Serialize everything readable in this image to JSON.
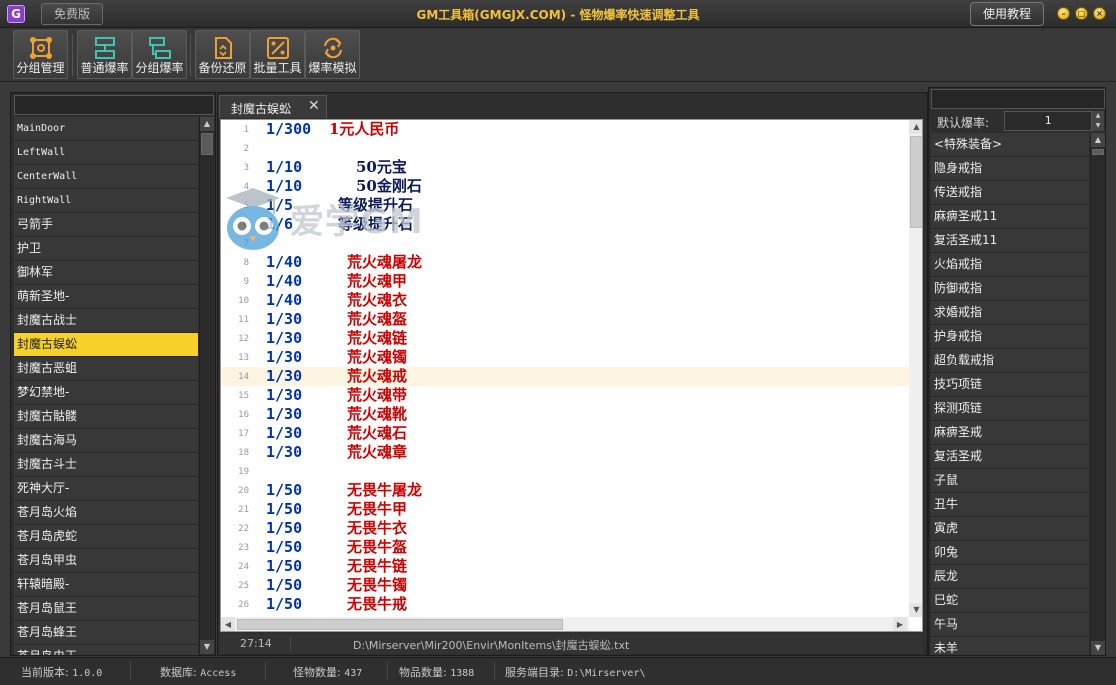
{
  "titlebar": {
    "free_label": "免费版",
    "title": "GM工具箱(GMGJX.COM) - 怪物爆率快速调整工具",
    "help_label": "使用教程"
  },
  "toolbar": {
    "buttons": [
      {
        "label": "分组管理",
        "icon": "group-manage-icon"
      },
      {
        "label": "普通爆率",
        "icon": "normal-droprate-icon"
      },
      {
        "label": "分组爆率",
        "icon": "group-droprate-icon"
      },
      {
        "label": "备份还原",
        "icon": "backup-restore-icon"
      },
      {
        "label": "批量工具",
        "icon": "batch-tool-icon"
      },
      {
        "label": "爆率模拟",
        "icon": "droprate-sim-icon"
      }
    ]
  },
  "monster_list": [
    "MainDoor",
    "LeftWall",
    "CenterWall",
    "RightWall",
    "弓箭手",
    "护卫",
    "御林军",
    "萌新圣地-",
    "封魔古战士",
    "封魔古蜈蚣",
    "封魔古恶蛆",
    "梦幻禁地-",
    "封魔古骷髅",
    "封魔古海马",
    "封魔古斗士",
    "死神大厅-",
    "苍月岛火焰",
    "苍月岛虎蛇",
    "苍月岛甲虫",
    "轩辕暗殿-",
    "苍月岛鼠王",
    "苍月岛蜂王",
    "苍月岛虫王"
  ],
  "selected_monster": "封魔古蜈蚣",
  "editor": {
    "tab_label": "封魔古蜈蚣",
    "close_glyph": "✕",
    "lines": [
      {
        "n": "1",
        "rate": "1/300",
        "item": "1元人民币",
        "color": "red",
        "offset": 1
      },
      {
        "n": "2",
        "rate": "",
        "item": "",
        "color": "red",
        "offset": 0
      },
      {
        "n": "3",
        "rate": "1/10",
        "item": "50元宝",
        "color": "navy",
        "offset": 4
      },
      {
        "n": "4",
        "rate": "1/10",
        "item": "50金刚石",
        "color": "navy",
        "offset": 4
      },
      {
        "n": "5",
        "rate": "1/5",
        "item": "等级提升石",
        "color": "navy",
        "offset": 2
      },
      {
        "n": "6",
        "rate": "1/6",
        "item": "等级提升石",
        "color": "navy",
        "offset": 2
      },
      {
        "n": "7",
        "rate": "",
        "item": "",
        "color": "red",
        "offset": 0
      },
      {
        "n": "8",
        "rate": "1/40",
        "item": "荒火魂屠龙",
        "color": "red",
        "offset": 3
      },
      {
        "n": "9",
        "rate": "1/40",
        "item": "荒火魂甲",
        "color": "red",
        "offset": 3
      },
      {
        "n": "10",
        "rate": "1/40",
        "item": "荒火魂衣",
        "color": "red",
        "offset": 3
      },
      {
        "n": "11",
        "rate": "1/30",
        "item": "荒火魂盔",
        "color": "red",
        "offset": 3
      },
      {
        "n": "12",
        "rate": "1/30",
        "item": "荒火魂链",
        "color": "red",
        "offset": 3
      },
      {
        "n": "13",
        "rate": "1/30",
        "item": "荒火魂镯",
        "color": "red",
        "offset": 3
      },
      {
        "n": "14",
        "rate": "1/30",
        "item": "荒火魂戒",
        "color": "red",
        "offset": 3
      },
      {
        "n": "15",
        "rate": "1/30",
        "item": "荒火魂带",
        "color": "red",
        "offset": 3
      },
      {
        "n": "16",
        "rate": "1/30",
        "item": "荒火魂靴",
        "color": "red",
        "offset": 3
      },
      {
        "n": "17",
        "rate": "1/30",
        "item": "荒火魂石",
        "color": "red",
        "offset": 3
      },
      {
        "n": "18",
        "rate": "1/30",
        "item": "荒火魂章",
        "color": "red",
        "offset": 3
      },
      {
        "n": "19",
        "rate": "",
        "item": "",
        "color": "red",
        "offset": 0
      },
      {
        "n": "20",
        "rate": "1/50",
        "item": "无畏牛屠龙",
        "color": "red",
        "offset": 3
      },
      {
        "n": "21",
        "rate": "1/50",
        "item": "无畏牛甲",
        "color": "red",
        "offset": 3
      },
      {
        "n": "22",
        "rate": "1/50",
        "item": "无畏牛衣",
        "color": "red",
        "offset": 3
      },
      {
        "n": "23",
        "rate": "1/50",
        "item": "无畏牛盔",
        "color": "red",
        "offset": 3
      },
      {
        "n": "24",
        "rate": "1/50",
        "item": "无畏牛链",
        "color": "red",
        "offset": 3
      },
      {
        "n": "25",
        "rate": "1/50",
        "item": "无畏牛镯",
        "color": "red",
        "offset": 3
      },
      {
        "n": "26",
        "rate": "1/50",
        "item": "无畏牛戒",
        "color": "red",
        "offset": 3
      }
    ],
    "current_line": "14",
    "cursor_pos": "27:14",
    "file_path": "D:\\Mirserver\\Mir200\\Envir\\MonItems\\封魔古蜈蚣.txt"
  },
  "watermark": {
    "text": "爱学GM"
  },
  "right_panel": {
    "default_rate_label": "默认爆率:",
    "default_rate_value": "1",
    "items": [
      "<特殊装备>",
      "隐身戒指",
      "传送戒指",
      "麻痹圣戒11",
      "复活圣戒11",
      "火焰戒指",
      "防御戒指",
      "求婚戒指",
      "护身戒指",
      "超负载戒指",
      "技巧项链",
      "探测项链",
      "麻痹圣戒",
      "复活圣戒",
      "子鼠",
      "丑牛",
      "寅虎",
      "卯兔",
      "辰龙",
      "巳蛇",
      "午马",
      "未羊"
    ]
  },
  "statusbar": {
    "version_label": "当前版本:",
    "version_value": "1.0.0",
    "db_label": "数据库:",
    "db_value": "Access",
    "monster_count_label": "怪物数量:",
    "monster_count_value": "437",
    "item_count_label": "物品数量:",
    "item_count_value": "1388",
    "server_dir_label": "服务端目录:",
    "server_dir_value": "D:\\Mirserver\\"
  },
  "colors": {
    "title_gold": "#f2c23a",
    "selected_yellow": "#f7d02a",
    "rate_blue": "#0033aa",
    "item_red": "#cc0000",
    "item_navy": "#0a1a5a"
  }
}
